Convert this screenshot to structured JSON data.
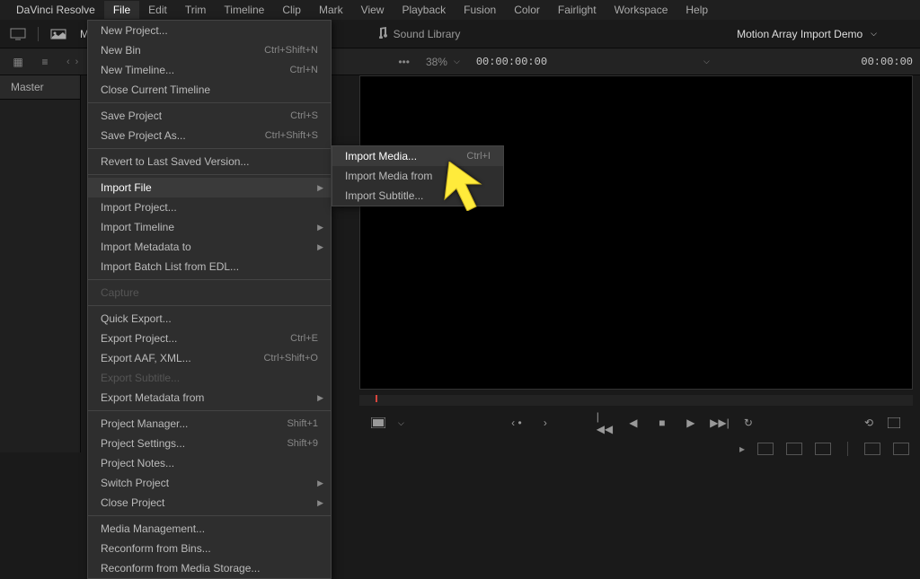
{
  "menubar": {
    "app": "DaVinci Resolve",
    "items": [
      "File",
      "Edit",
      "Trim",
      "Timeline",
      "Clip",
      "Mark",
      "View",
      "Playback",
      "Fusion",
      "Color",
      "Fairlight",
      "Workspace",
      "Help"
    ],
    "active_index": 0
  },
  "toolbar": {
    "media_label": "Me",
    "sound_library": "Sound Library",
    "project_title": "Motion Array Import Demo"
  },
  "secondary": {
    "zoom": "38%",
    "timecode_left": "00:00:00:00",
    "timecode_right": "00:00:00"
  },
  "media_panel": {
    "master": "Master"
  },
  "file_menu": [
    {
      "label": "New Project...",
      "shortcut": "",
      "type": "item"
    },
    {
      "label": "New Bin",
      "shortcut": "Ctrl+Shift+N",
      "type": "item"
    },
    {
      "label": "New Timeline...",
      "shortcut": "Ctrl+N",
      "type": "item"
    },
    {
      "label": "Close Current Timeline",
      "shortcut": "",
      "type": "item"
    },
    {
      "type": "sep"
    },
    {
      "label": "Save Project",
      "shortcut": "Ctrl+S",
      "type": "item"
    },
    {
      "label": "Save Project As...",
      "shortcut": "Ctrl+Shift+S",
      "type": "item"
    },
    {
      "type": "sep"
    },
    {
      "label": "Revert to Last Saved Version...",
      "shortcut": "",
      "type": "item"
    },
    {
      "type": "sep"
    },
    {
      "label": "Import File",
      "shortcut": "",
      "type": "submenu",
      "highlighted": true
    },
    {
      "label": "Import Project...",
      "shortcut": "",
      "type": "item"
    },
    {
      "label": "Import Timeline",
      "shortcut": "",
      "type": "submenu"
    },
    {
      "label": "Import Metadata to",
      "shortcut": "",
      "type": "submenu"
    },
    {
      "label": "Import Batch List from EDL...",
      "shortcut": "",
      "type": "item"
    },
    {
      "type": "sep"
    },
    {
      "label": "Capture",
      "shortcut": "",
      "type": "item",
      "disabled": true
    },
    {
      "type": "sep"
    },
    {
      "label": "Quick Export...",
      "shortcut": "",
      "type": "item"
    },
    {
      "label": "Export Project...",
      "shortcut": "Ctrl+E",
      "type": "item"
    },
    {
      "label": "Export AAF, XML...",
      "shortcut": "Ctrl+Shift+O",
      "type": "item"
    },
    {
      "label": "Export Subtitle...",
      "shortcut": "",
      "type": "item",
      "disabled": true
    },
    {
      "label": "Export Metadata from",
      "shortcut": "",
      "type": "submenu"
    },
    {
      "type": "sep"
    },
    {
      "label": "Project Manager...",
      "shortcut": "Shift+1",
      "type": "item"
    },
    {
      "label": "Project Settings...",
      "shortcut": "Shift+9",
      "type": "item"
    },
    {
      "label": "Project Notes...",
      "shortcut": "",
      "type": "item"
    },
    {
      "label": "Switch Project",
      "shortcut": "",
      "type": "submenu"
    },
    {
      "label": "Close Project",
      "shortcut": "",
      "type": "submenu"
    },
    {
      "type": "sep"
    },
    {
      "label": "Media Management...",
      "shortcut": "",
      "type": "item"
    },
    {
      "label": "Reconform from Bins...",
      "shortcut": "",
      "type": "item"
    },
    {
      "label": "Reconform from Media Storage...",
      "shortcut": "",
      "type": "item"
    }
  ],
  "import_submenu": [
    {
      "label": "Import Media...",
      "shortcut": "Ctrl+I",
      "highlighted": true
    },
    {
      "label": "Import Media from",
      "shortcut": ""
    },
    {
      "label": "Import Subtitle...",
      "shortcut": ""
    }
  ]
}
